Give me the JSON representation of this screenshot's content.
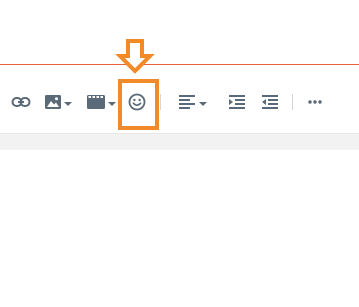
{
  "toolbar": {
    "tools": [
      {
        "name": "link",
        "icon": "link-icon"
      },
      {
        "name": "image",
        "icon": "image-icon",
        "has_dropdown": true
      },
      {
        "name": "media",
        "icon": "film-icon",
        "has_dropdown": true
      },
      {
        "name": "emoji",
        "icon": "smiley-icon",
        "highlighted": true
      },
      {
        "name": "align",
        "icon": "align-left-icon",
        "has_dropdown": true
      },
      {
        "name": "indent",
        "icon": "indent-icon"
      },
      {
        "name": "outdent",
        "icon": "outdent-icon"
      },
      {
        "name": "more",
        "icon": "more-horizontal-icon"
      }
    ]
  },
  "colors": {
    "accent_rule": "#e6623c",
    "annotation": "#f28a2a",
    "icon": "#5a6a78"
  },
  "annotation": {
    "target": "emoji",
    "arrow": "down-arrow-icon"
  }
}
